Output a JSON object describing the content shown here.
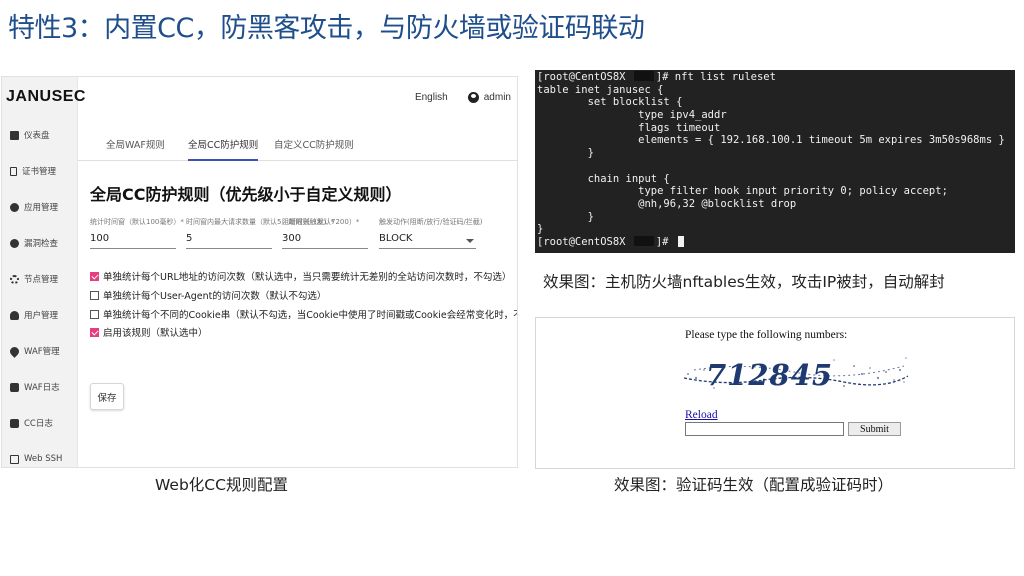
{
  "slide": {
    "title": "特性3：内置CC，防黑客攻击，与防火墙或验证码联动"
  },
  "app": {
    "logo": "JANUSEC",
    "topbar": {
      "language": "English",
      "user": "admin"
    },
    "sidebar": {
      "items": [
        {
          "label": "仪表盘",
          "icon": "dashboard-icon"
        },
        {
          "label": "证书管理",
          "icon": "certificate-icon"
        },
        {
          "label": "应用管理",
          "icon": "app-icon"
        },
        {
          "label": "漏洞检查",
          "icon": "scan-icon"
        },
        {
          "label": "节点管理",
          "icon": "gear-icon"
        },
        {
          "label": "用户管理",
          "icon": "user-icon"
        },
        {
          "label": "WAF管理",
          "icon": "waf-icon"
        },
        {
          "label": "WAF日志",
          "icon": "lock-icon"
        },
        {
          "label": "CC日志",
          "icon": "lock-icon"
        },
        {
          "label": "Web SSH",
          "icon": "terminal-icon"
        }
      ]
    },
    "tabs": [
      {
        "label": "全局WAF规则",
        "active": false
      },
      {
        "label": "全局CC防护规则",
        "active": true
      },
      {
        "label": "自定义CC防护规则",
        "active": false
      }
    ],
    "section_title": "全局CC防护规则（优先级小于自定义规则）",
    "fields": [
      {
        "label": "统计时间窗（默认100毫秒）*",
        "value": "100"
      },
      {
        "label": "时间窗内最大请求数量（默认5，超限则触发）*",
        "value": "5"
      },
      {
        "label": "阻断时长（默认7200）*",
        "value": "300"
      },
      {
        "label": "触发动作(阻断/放行/验证码/拦截)",
        "value": "BLOCK"
      }
    ],
    "checkboxes": [
      {
        "label": "单独统计每个URL地址的访问次数（默认选中，当只需要统计无差别的全站访问次数时，不勾选）",
        "checked": true
      },
      {
        "label": "单独统计每个User-Agent的访问次数（默认不勾选）",
        "checked": false
      },
      {
        "label": "单独统计每个不同的Cookie串（默认不勾选，当Cookie中使用了时间戳或Cookie会经常变化时，不勾选）",
        "checked": false
      },
      {
        "label": "启用该规则（默认选中）",
        "checked": true
      }
    ],
    "save_label": "保存",
    "accent_color": "#e73d7e",
    "tab_indicator_color": "#3f51b5"
  },
  "terminal": {
    "prompt_prefix": "[root@CentOS8X ",
    "prompt_suffix": "]# ",
    "command": "nft list ruleset",
    "lines": [
      "table inet janusec {",
      "        set blocklist {",
      "                type ipv4_addr",
      "                flags timeout",
      "                elements = { 192.168.100.1 timeout 5m expires 3m50s968ms }",
      "        }",
      "",
      "        chain input {",
      "                type filter hook input priority 0; policy accept;",
      "                @nh,96,32 @blocklist drop",
      "        }",
      "}"
    ]
  },
  "captions": {
    "terminal": "效果图：主机防火墙nftables生效，攻击IP被封，自动解封",
    "app": "Web化CC规则配置",
    "captcha": "效果图：验证码生效（配置成验证码时）"
  },
  "captcha": {
    "prompt": "Please type the following numbers:",
    "code": "712845",
    "reload_label": "Reload",
    "input_value": "",
    "submit_label": "Submit"
  }
}
